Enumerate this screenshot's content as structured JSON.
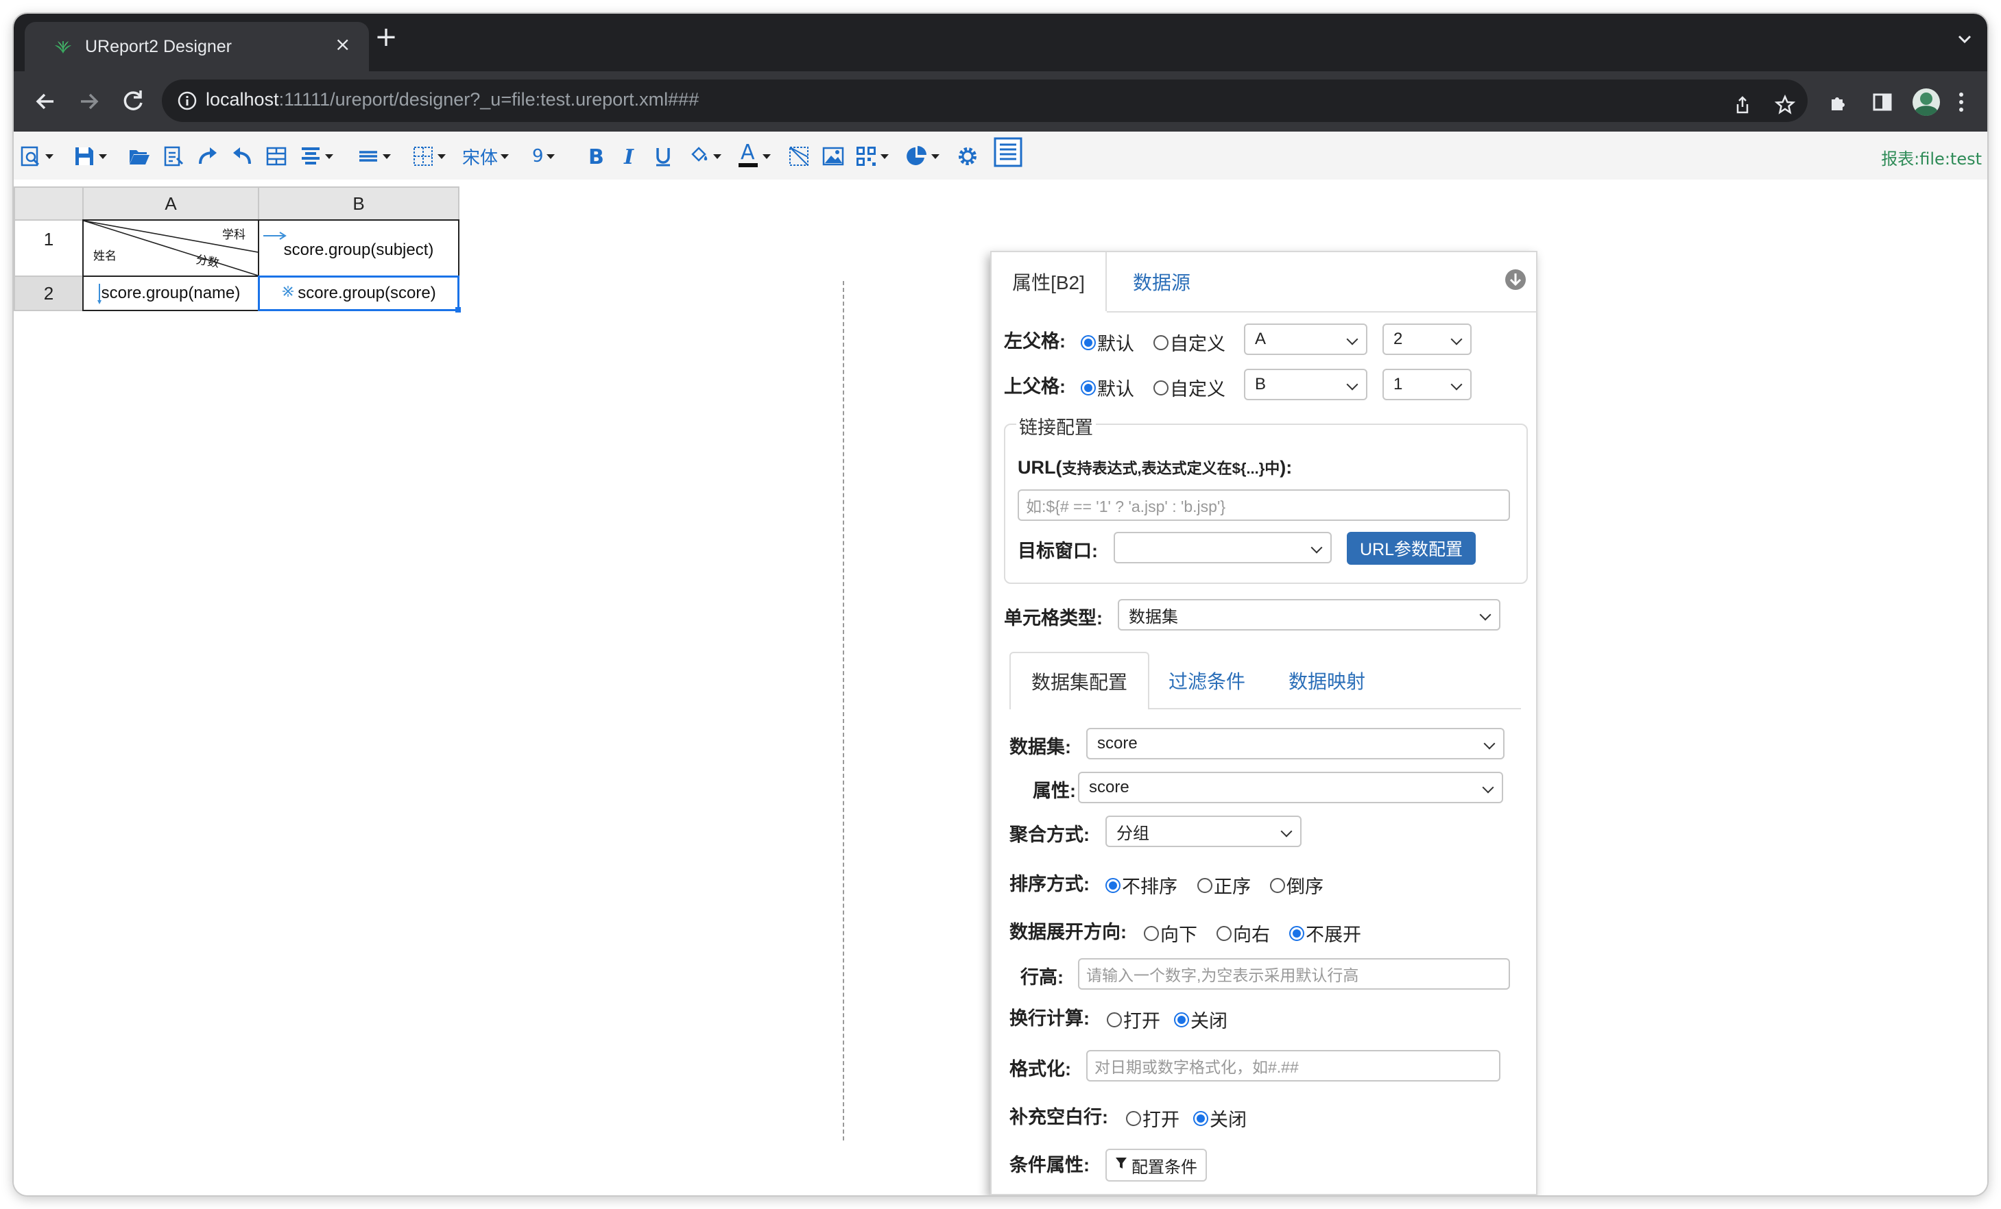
{
  "browser": {
    "tab_title": "UReport2 Designer",
    "tab_close": "×",
    "new_tab": "+",
    "url_host": "localhost",
    "url_rest": ":11111/ureport/designer?_u=file:test.ureport.xml###"
  },
  "toolbar": {
    "font_name": "宋体",
    "font_size": "9",
    "report_label": "报表:file:test",
    "icons": [
      "preview-icon",
      "save-icon",
      "open-icon",
      "import-icon",
      "redo-icon",
      "undo-icon",
      "merge-cells-icon",
      "align-icon",
      "valign-icon",
      "border-icon",
      "font-name-select",
      "font-size-select",
      "bold-icon",
      "italic-icon",
      "underline-icon",
      "fill-color-icon",
      "font-color-icon",
      "slash-icon",
      "image-icon",
      "qrcode-icon",
      "chart-icon",
      "settings-icon",
      "paper-settings-icon"
    ]
  },
  "sheet": {
    "columns": [
      "A",
      "B"
    ],
    "rows": [
      "1",
      "2"
    ],
    "a1_top": "学科",
    "a1_left": "姓名",
    "a1_mid": "分数",
    "b1": "score.group(subject)",
    "a2": "score.group(name)",
    "b2": "score.group(score)"
  },
  "panel": {
    "tab_props": "属性[B2]",
    "tab_datasource": "数据源",
    "left_parent_label": "左父格:",
    "top_parent_label": "上父格:",
    "opt_default": "默认",
    "opt_custom": "自定义",
    "left_parent_col": "A",
    "left_parent_row": "2",
    "top_parent_col": "B",
    "top_parent_row": "1",
    "link_legend": "链接配置",
    "url_label_bold": "URL(",
    "url_label_note": "支持表达式,表达式定义在${...}中",
    "url_label_end": "):",
    "url_placeholder": "如:${# == '1' ? 'a.jsp' : 'b.jsp'}",
    "target_label": "目标窗口:",
    "target_value": "",
    "url_param_button": "URL参数配置",
    "cell_type_label": "单元格类型:",
    "cell_type_value": "数据集",
    "subtab_dataset": "数据集配置",
    "subtab_filter": "过滤条件",
    "subtab_mapping": "数据映射",
    "dataset_label": "数据集:",
    "dataset_value": "score",
    "property_label": "属性:",
    "property_value": "score",
    "agg_label": "聚合方式:",
    "agg_value": "分组",
    "sort_label": "排序方式:",
    "sort_none": "不排序",
    "sort_asc": "正序",
    "sort_desc": "倒序",
    "expand_label": "数据展开方向:",
    "expand_down": "向下",
    "expand_right": "向右",
    "expand_none": "不展开",
    "row_height_label": "行高:",
    "row_height_placeholder": "请输入一个数字,为空表示采用默认行高",
    "wrap_label": "换行计算:",
    "opt_on": "打开",
    "opt_off": "关闭",
    "format_label": "格式化:",
    "format_placeholder": "对日期或数字格式化，如#.##",
    "fill_blank_label": "补充空白行:",
    "cond_label": "条件属性:",
    "cond_button": "配置条件"
  },
  "colors": {
    "accent": "#1a73e8",
    "link": "#2a6eb8",
    "button": "#2f6eb5",
    "toolbar_icon": "#1e6ec8"
  }
}
